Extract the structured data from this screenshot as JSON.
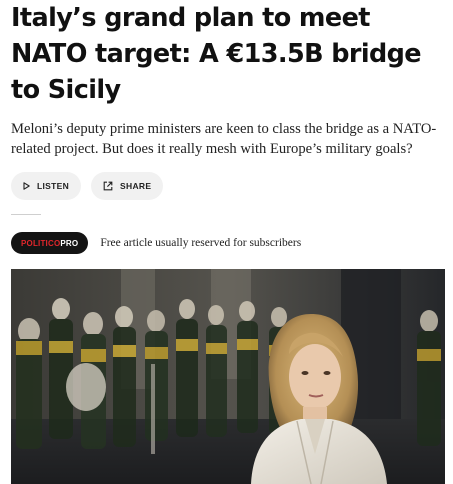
{
  "article": {
    "headline": "Italy’s grand plan to meet NATO target: A €13.5B bridge to Sicily",
    "dek": "Meloni’s deputy prime ministers are keen to class the bridge as a NATO-related project. But does it really mesh with Europe’s military goals?"
  },
  "actions": {
    "listen": {
      "label": "LISTEN",
      "icon": "play-icon"
    },
    "share": {
      "label": "SHARE",
      "icon": "share-icon"
    }
  },
  "pro": {
    "badge_brand": "POLITICO",
    "badge_tier": "PRO",
    "brand_color": "#e0262b",
    "note": "Free article usually reserved for subscribers"
  },
  "image": {
    "subject": "photo-giorgia-meloni-with-honor-guard"
  }
}
